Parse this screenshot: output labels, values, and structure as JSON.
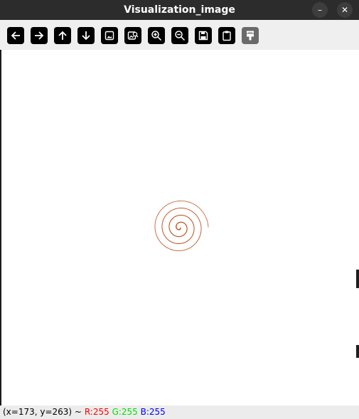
{
  "window": {
    "title": "Visualization_image",
    "minimize_glyph": "–",
    "close_glyph": "✕"
  },
  "toolbar": {
    "tools": [
      {
        "name": "pan-left-icon"
      },
      {
        "name": "pan-right-icon"
      },
      {
        "name": "pan-up-icon"
      },
      {
        "name": "pan-down-icon"
      },
      {
        "name": "zoom-fit-icon"
      },
      {
        "name": "zoom-original-icon"
      },
      {
        "name": "zoom-in-icon"
      },
      {
        "name": "zoom-out-icon"
      },
      {
        "name": "save-icon"
      },
      {
        "name": "copy-clipboard-icon"
      },
      {
        "name": "properties-icon",
        "disabled": true
      }
    ]
  },
  "image": {
    "spiral_color": "#c0501e"
  },
  "status": {
    "coords": "(x=173, y=263) ~",
    "r": "R:255",
    "g": "G:255",
    "b": "B:255"
  }
}
